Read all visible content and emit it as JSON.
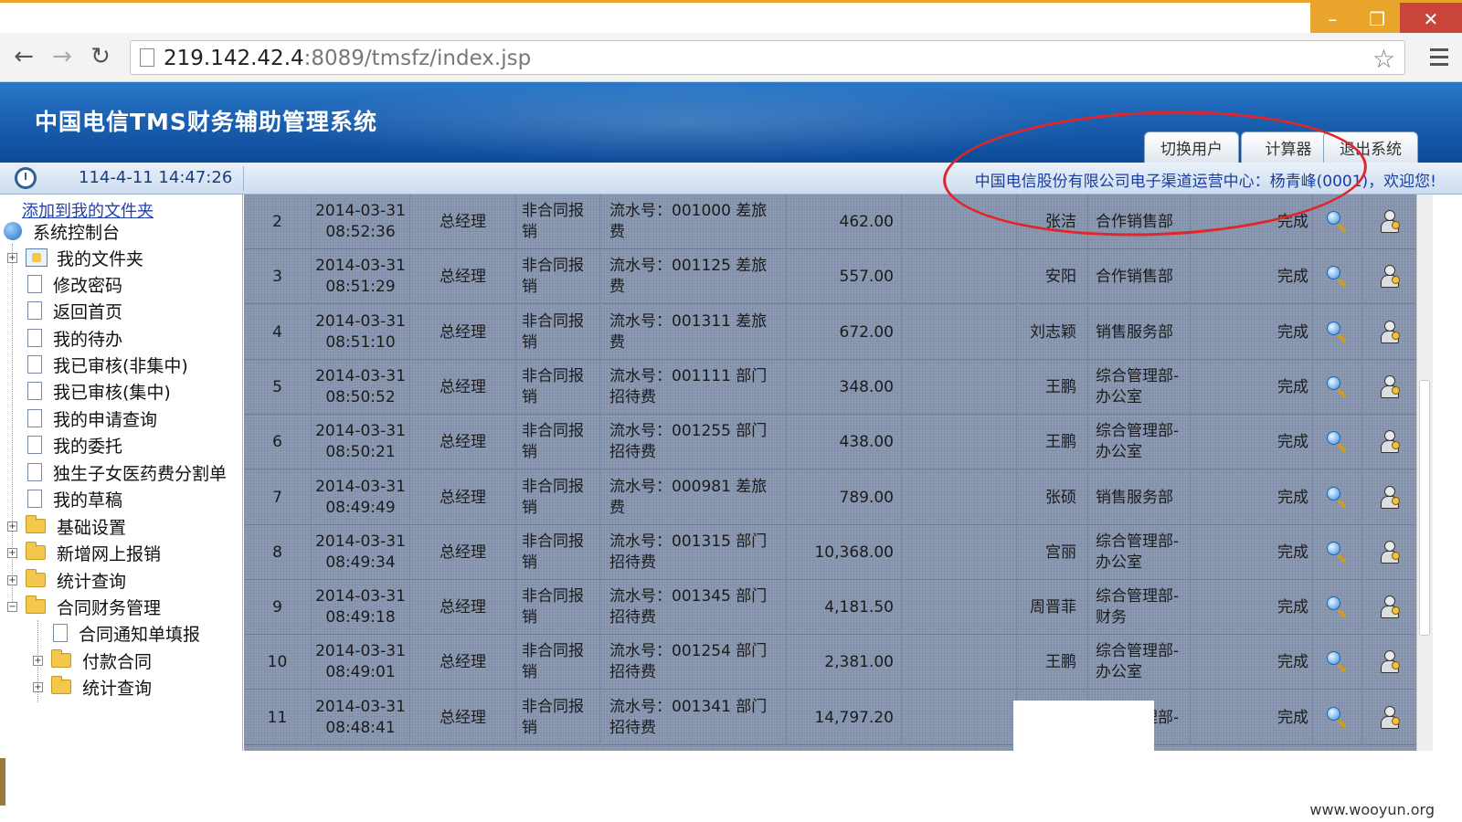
{
  "window": {
    "minimize": "–",
    "restore": "❐",
    "close": "✕"
  },
  "browser": {
    "url_host": "219.142.42.4",
    "url_rest": ":8089/tmsfz/index.jsp",
    "back": "←",
    "forward": "→",
    "reload": "↻",
    "star": "☆"
  },
  "header": {
    "title": "中国电信TMS财务辅助管理系统",
    "buttons": [
      "切换用户",
      "计算器",
      "退出系统"
    ]
  },
  "infobar": {
    "datetime": "114-4-11 14:47:26",
    "welcome": "中国电信股份有限公司电子渠道运营中心：杨青峰(0001)，欢迎您!"
  },
  "sidebar": {
    "add_favorite": "添加到我的文件夹",
    "items": [
      {
        "label": "系统控制台"
      },
      {
        "label": "我的文件夹"
      },
      {
        "label": "修改密码"
      },
      {
        "label": "返回首页"
      },
      {
        "label": "我的待办"
      },
      {
        "label": "我已审核(非集中)"
      },
      {
        "label": "我已审核(集中)"
      },
      {
        "label": "我的申请查询"
      },
      {
        "label": "我的委托"
      },
      {
        "label": "独生子女医药费分割单"
      },
      {
        "label": "我的草稿"
      },
      {
        "label": "基础设置"
      },
      {
        "label": "新增网上报销"
      },
      {
        "label": "统计查询"
      },
      {
        "label": "合同财务管理"
      },
      {
        "label": "合同通知单填报"
      },
      {
        "label": "付款合同"
      },
      {
        "label": "统计查询"
      }
    ]
  },
  "rows": [
    {
      "idx": "2",
      "date": "2014-03-31",
      "time": "08:52:36",
      "role": "总经理",
      "type1": "非合同报",
      "type2": "销",
      "desc1": "流水号：001000 差旅",
      "desc2": "费",
      "amount": "462.00",
      "name": "张洁",
      "dept1": "合作销售部",
      "dept2": "",
      "status": "完成"
    },
    {
      "idx": "3",
      "date": "2014-03-31",
      "time": "08:51:29",
      "role": "总经理",
      "type1": "非合同报",
      "type2": "销",
      "desc1": "流水号：001125 差旅",
      "desc2": "费",
      "amount": "557.00",
      "name": "安阳",
      "dept1": "合作销售部",
      "dept2": "",
      "status": "完成"
    },
    {
      "idx": "4",
      "date": "2014-03-31",
      "time": "08:51:10",
      "role": "总经理",
      "type1": "非合同报",
      "type2": "销",
      "desc1": "流水号：001311 差旅",
      "desc2": "费",
      "amount": "672.00",
      "name": "刘志颖",
      "dept1": "销售服务部",
      "dept2": "",
      "status": "完成"
    },
    {
      "idx": "5",
      "date": "2014-03-31",
      "time": "08:50:52",
      "role": "总经理",
      "type1": "非合同报",
      "type2": "销",
      "desc1": "流水号：001111 部门",
      "desc2": "招待费",
      "amount": "348.00",
      "name": "王鹏",
      "dept1": "综合管理部-",
      "dept2": "办公室",
      "status": "完成"
    },
    {
      "idx": "6",
      "date": "2014-03-31",
      "time": "08:50:21",
      "role": "总经理",
      "type1": "非合同报",
      "type2": "销",
      "desc1": "流水号：001255 部门",
      "desc2": "招待费",
      "amount": "438.00",
      "name": "王鹏",
      "dept1": "综合管理部-",
      "dept2": "办公室",
      "status": "完成"
    },
    {
      "idx": "7",
      "date": "2014-03-31",
      "time": "08:49:49",
      "role": "总经理",
      "type1": "非合同报",
      "type2": "销",
      "desc1": "流水号：000981 差旅",
      "desc2": "费",
      "amount": "789.00",
      "name": "张硕",
      "dept1": "销售服务部",
      "dept2": "",
      "status": "完成"
    },
    {
      "idx": "8",
      "date": "2014-03-31",
      "time": "08:49:34",
      "role": "总经理",
      "type1": "非合同报",
      "type2": "销",
      "desc1": "流水号：001315 部门",
      "desc2": "招待费",
      "amount": "10,368.00",
      "name": "宫丽",
      "dept1": "综合管理部-",
      "dept2": "办公室",
      "status": "完成"
    },
    {
      "idx": "9",
      "date": "2014-03-31",
      "time": "08:49:18",
      "role": "总经理",
      "type1": "非合同报",
      "type2": "销",
      "desc1": "流水号：001345 部门",
      "desc2": "招待费",
      "amount": "4,181.50",
      "name": "周晋菲",
      "dept1": "综合管理部-",
      "dept2": "财务",
      "status": "完成"
    },
    {
      "idx": "10",
      "date": "2014-03-31",
      "time": "08:49:01",
      "role": "总经理",
      "type1": "非合同报",
      "type2": "销",
      "desc1": "流水号：001254 部门",
      "desc2": "招待费",
      "amount": "2,381.00",
      "name": "王鹏",
      "dept1": "综合管理部-",
      "dept2": "办公室",
      "status": "完成"
    },
    {
      "idx": "11",
      "date": "2014-03-31",
      "time": "08:48:41",
      "role": "总经理",
      "type1": "非合同报",
      "type2": "销",
      "desc1": "流水号：001341 部门",
      "desc2": "招待费",
      "amount": "14,797.20",
      "name": "",
      "dept1": "综合管理部-",
      "dept2": "",
      "status": "完成"
    }
  ],
  "watermark": "www.wooyun.org"
}
